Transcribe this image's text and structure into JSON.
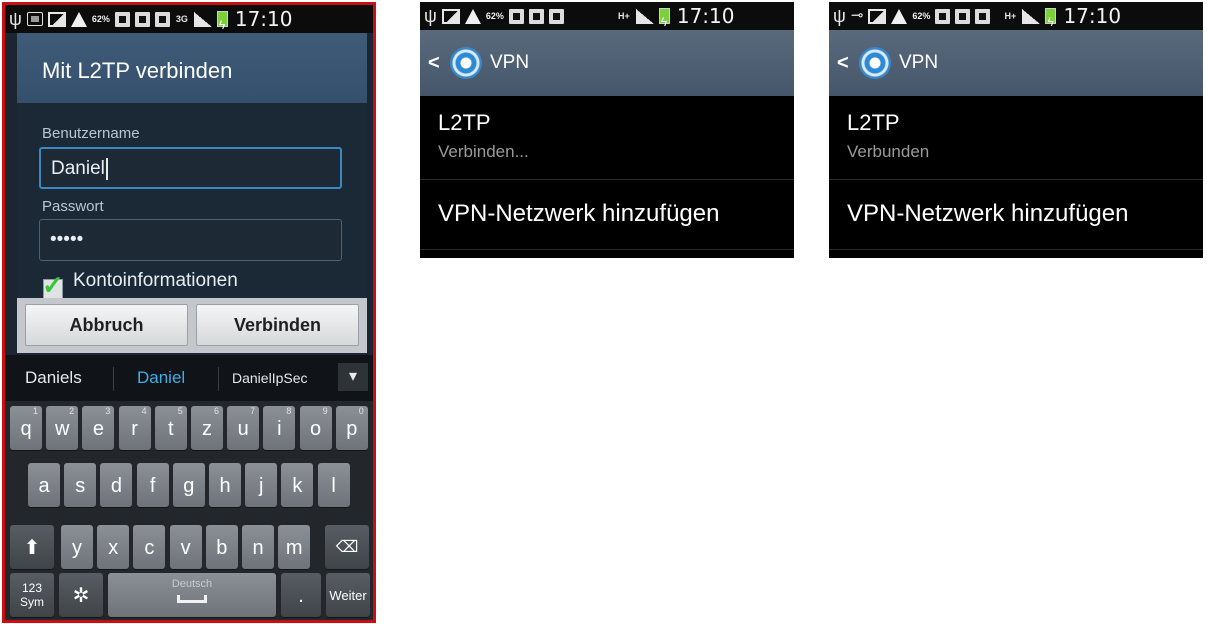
{
  "status_bar": {
    "battery_percent": "62%",
    "time": "17:10",
    "network_left": "3G",
    "network_right": "H+"
  },
  "dialog": {
    "title": "Mit L2TP verbinden",
    "username_label": "Benutzername",
    "username_value": "Daniel",
    "password_label": "Passwort",
    "password_value": "•••••",
    "remember_label": "Kontoinformationen",
    "remember_checked": true,
    "cancel_label": "Abbruch",
    "connect_label": "Verbinden"
  },
  "keyboard": {
    "suggestions": [
      "Daniels",
      "Daniel",
      "DanielIpSec"
    ],
    "row1": [
      {
        "k": "q",
        "n": "1"
      },
      {
        "k": "w",
        "n": "2"
      },
      {
        "k": "e",
        "n": "3"
      },
      {
        "k": "r",
        "n": "4"
      },
      {
        "k": "t",
        "n": "5"
      },
      {
        "k": "z",
        "n": "6"
      },
      {
        "k": "u",
        "n": "7"
      },
      {
        "k": "i",
        "n": "8"
      },
      {
        "k": "o",
        "n": "9"
      },
      {
        "k": "p",
        "n": "0"
      }
    ],
    "row2": [
      "a",
      "s",
      "d",
      "f",
      "g",
      "h",
      "j",
      "k",
      "l"
    ],
    "row3": [
      "y",
      "x",
      "c",
      "v",
      "b",
      "n",
      "m"
    ],
    "sym_label": "123\nSym",
    "space_label": "Deutsch",
    "period_label": ".",
    "enter_label": "Weiter"
  },
  "vpn_screen_1": {
    "title": "VPN",
    "profile_name": "L2TP",
    "profile_status": "Verbinden...",
    "add_label": "VPN-Netzwerk hinzufügen"
  },
  "vpn_screen_2": {
    "title": "VPN",
    "profile_name": "L2TP",
    "profile_status": "Verbunden",
    "add_label": "VPN-Netzwerk hinzufügen"
  }
}
